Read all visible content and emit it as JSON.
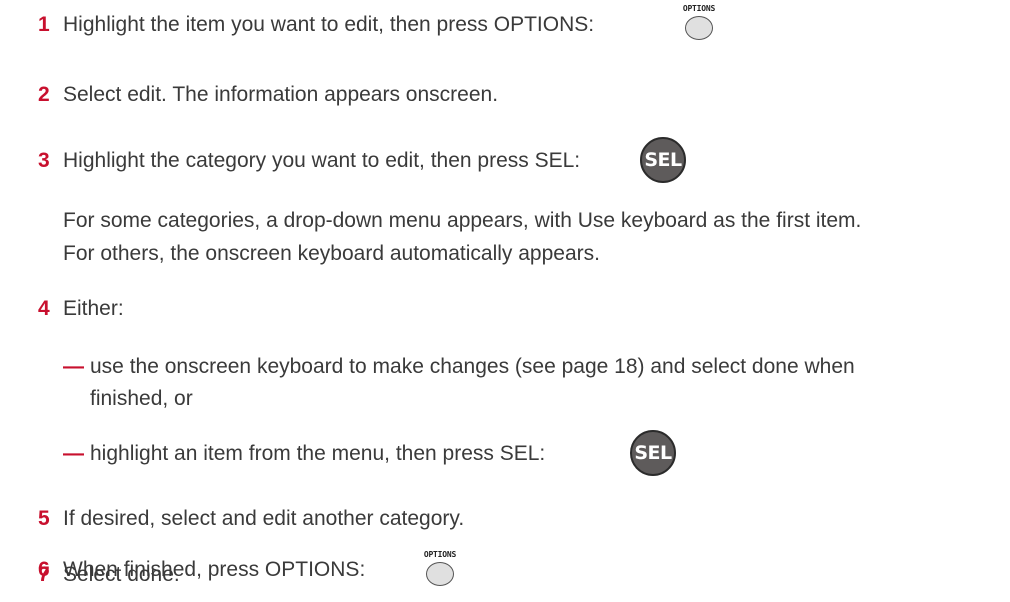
{
  "steps": [
    {
      "num": "1",
      "text": "Highlight the item you want to edit, then press OPTIONS:"
    },
    {
      "num": "2",
      "text": "Select edit. The information appears onscreen."
    },
    {
      "num": "3",
      "text": "Highlight the category you want to edit, then press SEL:"
    },
    {
      "num": "4",
      "text": "Either:"
    },
    {
      "num": "5",
      "text": "If desired, select and edit another category."
    },
    {
      "num": "6",
      "text": "When finished, press OPTIONS:"
    },
    {
      "num": "7",
      "text": "Select done."
    }
  ],
  "step3_note": {
    "line1": "For some categories, a drop-down menu appears, with Use keyboard as the first item.",
    "line2": "For others, the onscreen keyboard automatically appears."
  },
  "step4_options": [
    {
      "dash": "—",
      "line1": "use the onscreen keyboard to make changes (see page 18) and select done when",
      "line2": "finished, or"
    },
    {
      "dash": "—",
      "line1": "highlight an item from the menu, then press SEL:"
    }
  ],
  "buttons": {
    "options_label": "OPTIONS",
    "sel_label": "SEL",
    "options_icon": "options-button-icon",
    "sel_icon": "sel-button-icon"
  },
  "colors": {
    "step_number": "#c8102e",
    "body_text": "#3a3a3a",
    "sel_button_fill": "#5e5b5b",
    "options_button_fill": "#e0e0e0"
  }
}
